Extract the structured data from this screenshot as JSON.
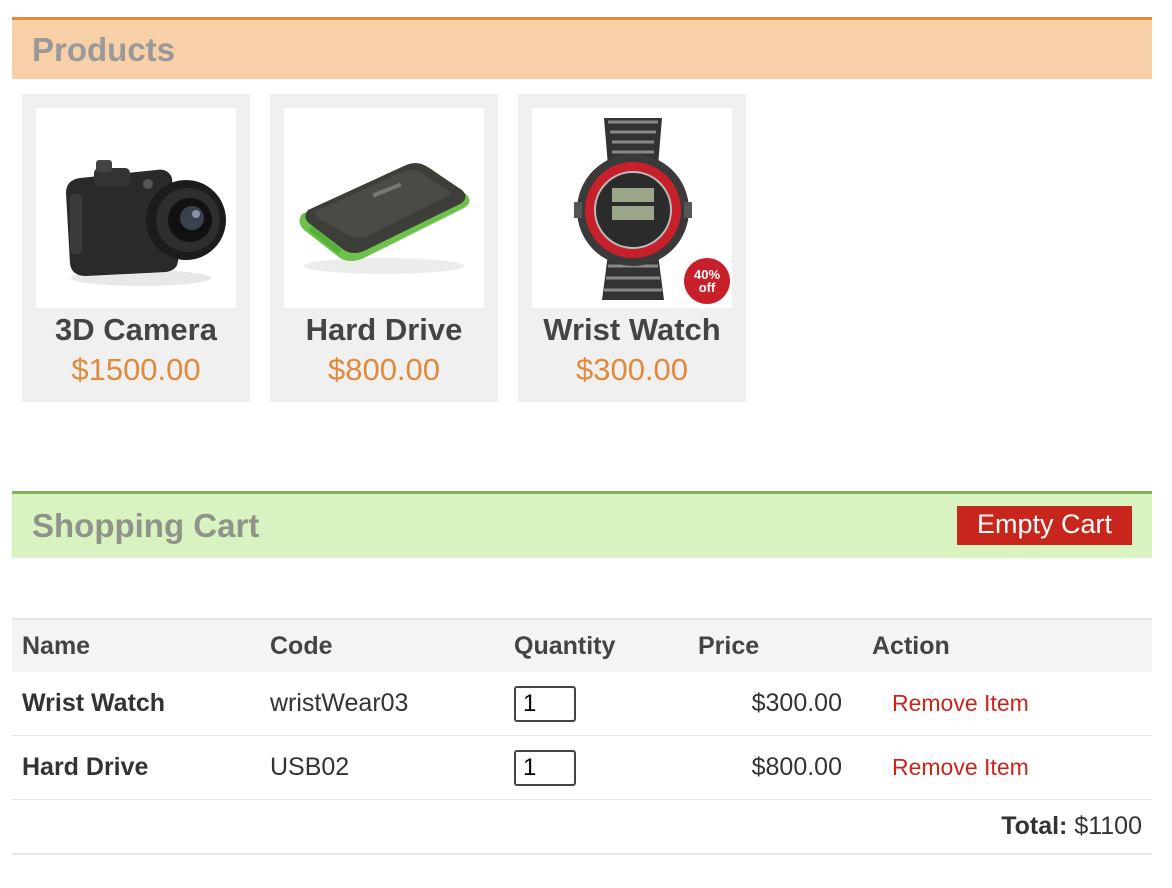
{
  "products": {
    "title": "Products",
    "items": [
      {
        "name": "3D Camera",
        "price": "$1500.00",
        "image": "camera-image"
      },
      {
        "name": "Hard Drive",
        "price": "$800.00",
        "image": "hard-drive-image"
      },
      {
        "name": "Wrist Watch",
        "price": "$300.00",
        "image": "wrist-watch-image",
        "badge": "40% off"
      }
    ]
  },
  "cart": {
    "title": "Shopping Cart",
    "empty_label": "Empty Cart",
    "columns": [
      "Name",
      "Code",
      "Quantity",
      "Price",
      "Action"
    ],
    "rows": [
      {
        "name": "Wrist Watch",
        "code": "wristWear03",
        "quantity": "1",
        "price": "$300.00",
        "action": "Remove Item"
      },
      {
        "name": "Hard Drive",
        "code": "USB02",
        "quantity": "1",
        "price": "$800.00",
        "action": "Remove Item"
      }
    ],
    "total_label": "Total:",
    "total_value": "$1100"
  },
  "colors": {
    "products_header_bg": "#f8d0a8",
    "products_header_border": "#e8893f",
    "cart_header_bg": "#d8f2c0",
    "cart_header_border": "#7cb955",
    "price": "#e08a3c",
    "danger": "#c8261c"
  }
}
